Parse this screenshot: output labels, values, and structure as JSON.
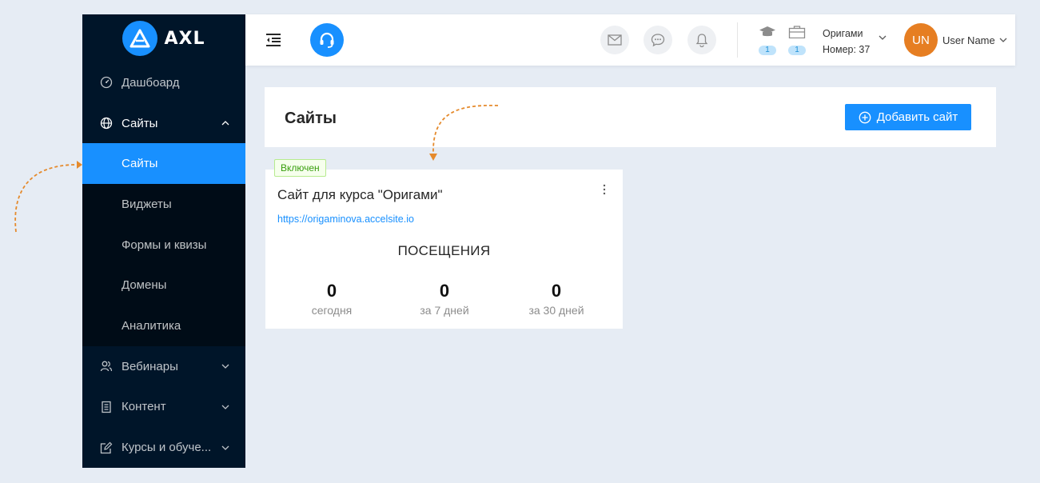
{
  "brand": {
    "name": "AXL"
  },
  "sidebar": {
    "dashboard": "Дашбоард",
    "sites_group": "Сайты",
    "sub_items": [
      "Сайты",
      "Виджеты",
      "Формы и квизы",
      "Домены",
      "Аналитика"
    ],
    "webinars": "Вебинары",
    "content": "Контент",
    "courses": "Курсы и обуче..."
  },
  "header": {
    "course_count": "1",
    "case_count": "1",
    "org_name": "Оригами",
    "org_number": "Номер: 37",
    "avatar_initials": "UN",
    "user_name": "User Name"
  },
  "page": {
    "title": "Сайты",
    "add_button": "Добавить сайт"
  },
  "site_card": {
    "status": "Включен",
    "title": "Сайт для курса \"Оригами\"",
    "url": "https://origaminova.accelsite.io",
    "visits_heading": "ПОСЕЩЕНИЯ",
    "stats": [
      {
        "value": "0",
        "label": "сегодня"
      },
      {
        "value": "0",
        "label": "за 7 дней"
      },
      {
        "value": "0",
        "label": "за 30 дней"
      }
    ]
  },
  "colors": {
    "sidebar": "#001529",
    "submenu": "#000c17",
    "accent": "#1890ff",
    "avatar": "#e67e22",
    "annotation_arrow": "#e58a2c"
  }
}
